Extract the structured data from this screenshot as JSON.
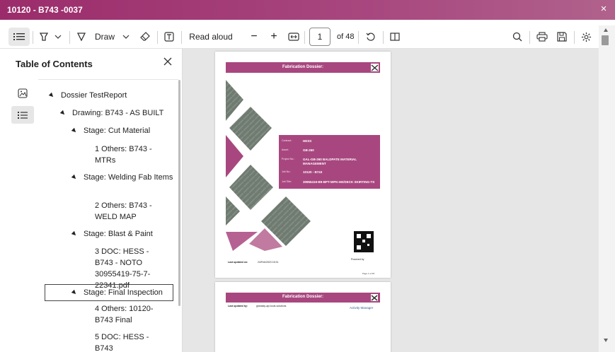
{
  "window": {
    "title": "10120 - B743 -0037",
    "close_glyph": "×"
  },
  "toolbar": {
    "contents_icon": "contents-list-icon",
    "highlight_icon": "highlighter-icon",
    "draw_label": "Draw",
    "erase_icon": "eraser-icon",
    "textbox_icon": "text-box-icon",
    "read_aloud_label": "Read aloud",
    "zoom_out_glyph": "−",
    "zoom_in_glyph": "+",
    "fit_icon": "fit-page-icon",
    "page_number": "1",
    "page_total": "of 48",
    "rotate_icon": "rotate-icon",
    "page_view_icon": "page-view-icon",
    "search_icon": "search-icon",
    "print_icon": "print-icon",
    "save_icon": "save-icon",
    "settings_icon": "gear-icon"
  },
  "toc": {
    "title": "Table of Contents",
    "items": [
      {
        "label": "Dossier TestReport",
        "level": 0,
        "expanded": true
      },
      {
        "label": "Drawing: B743 - AS BUILT",
        "level": 1,
        "expanded": true
      },
      {
        "label": "Stage: Cut Material",
        "level": 2,
        "expanded": true
      },
      {
        "label": "1 Others: B743 - MTRs",
        "level": 3
      },
      {
        "label": "Stage: Welding Fab Items",
        "level": 2,
        "expanded": true
      },
      {
        "label": "2 Others: B743 - WELD MAP",
        "level": 3
      },
      {
        "label": "Stage: Blast & Paint",
        "level": 2,
        "expanded": true
      },
      {
        "label": "3 DOC: HESS - B743 - NOTO 30955419-75-7-22341.pdf",
        "level": 3
      },
      {
        "label": "Stage: Final Inspection",
        "level": 2,
        "expanded": true,
        "focused": true
      },
      {
        "label": "4 Others: 10120-B743 Final",
        "level": 3
      },
      {
        "label": "5 DOC: HESS - B743",
        "level": 3
      }
    ]
  },
  "document": {
    "page1": {
      "header": "Fabrication Dossier:",
      "fields": [
        {
          "label": "Contract:",
          "value": "HESS"
        },
        {
          "label": "Asset:",
          "value": "GB-260"
        },
        {
          "label": "Project No.:",
          "value": "GAL-GB-260 BALDPATE MATERIAL MANAGEMENT"
        },
        {
          "label": "Job No.:",
          "value": "10120 - B743"
        },
        {
          "label": "Job Title:",
          "value": "30955419-B9-BPT-WPK-HE/DECK SKIRTING-TS"
        }
      ],
      "last_updated_label": "Last updated on:",
      "last_updated_value": "24/Feb/2023 15:31",
      "powered_by": "Powered by",
      "page_footer": "Page 1 of 48"
    },
    "page2": {
      "header": "Fabrication Dossier:",
      "last_updated_label": "Last updated by:",
      "last_updated_value": "globaldy-api-tools-solutions",
      "brand": "Activity Manager"
    }
  },
  "colors": {
    "brand": "#a8477f",
    "brand_dark": "#9b2c6b",
    "viewer_bg": "#e6e6e6"
  }
}
